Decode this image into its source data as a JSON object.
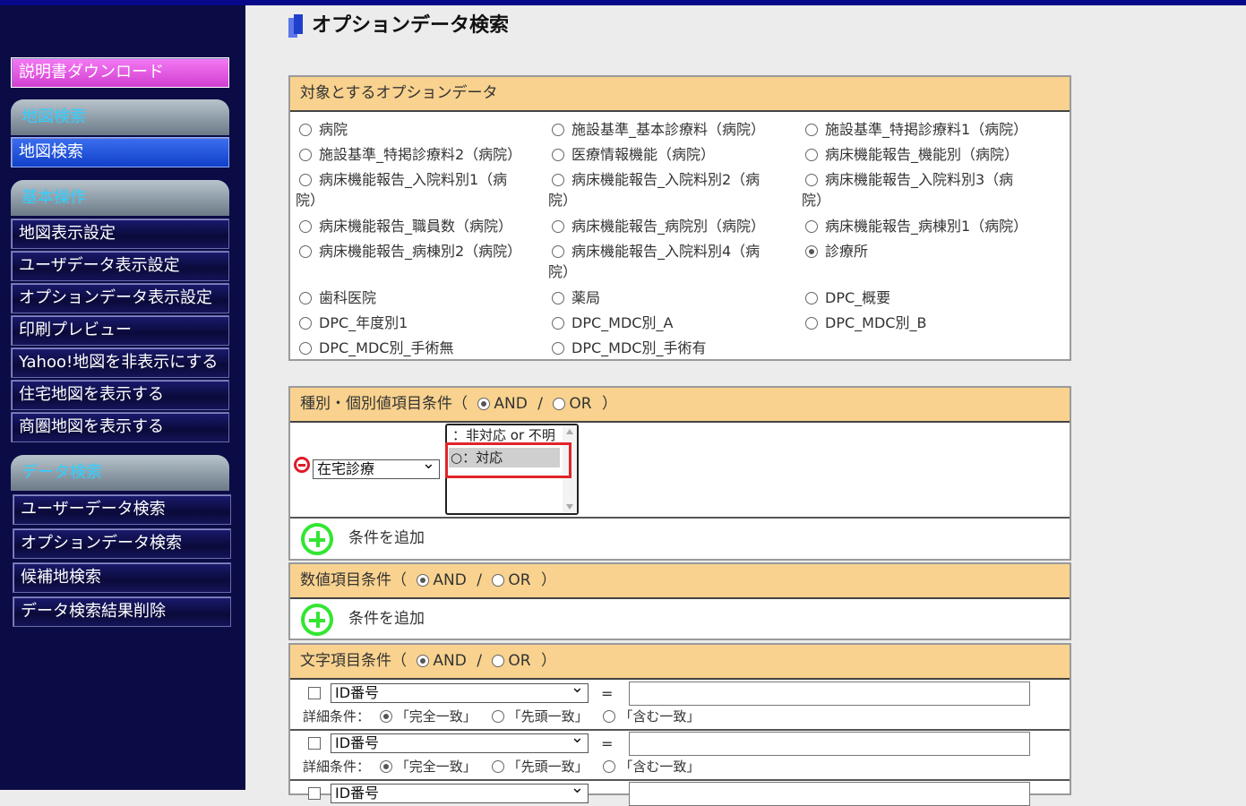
{
  "sidebar": {
    "manual_download": "説明書ダウンロード",
    "sections": [
      {
        "title": "地図検索",
        "items": [
          "地図検索"
        ]
      },
      {
        "title": "基本操作",
        "items": [
          "地図表示設定",
          "ユーザデータ表示設定",
          "オプションデータ表示設定",
          "印刷プレビュー",
          "Yahoo!地図を非表示にする",
          "住宅地図を表示する",
          "商圏地図を表示する"
        ]
      },
      {
        "title": "データ検索",
        "items": [
          "ユーザーデータ検索",
          "オプションデータ検索",
          "候補地検索",
          "データ検索結果削除"
        ]
      }
    ]
  },
  "page_title": "オプションデータ検索",
  "target_panel": {
    "header": "対象とするオプションデータ",
    "selected": "診療所",
    "options": [
      "病院",
      "施設基準_基本診療料（病院）",
      "施設基準_特掲診療料1（病院）",
      "施設基準_特掲診療料2（病院）",
      "医療情報機能（病院）",
      "病床機能報告_機能別（病院）",
      "病床機能報告_入院料別1（病院）",
      "病床機能報告_入院料別2（病院）",
      "病床機能報告_入院料別3（病院）",
      "病床機能報告_職員数（病院）",
      "病床機能報告_病院別（病院）",
      "病床機能報告_病棟別1（病院）",
      "病床機能報告_病棟別2（病院）",
      "病床機能報告_入院料別4（病院）",
      "診療所",
      "歯科医院",
      "薬局",
      "DPC_概要",
      "DPC_年度別1",
      "DPC_MDC別_A",
      "DPC_MDC別_B",
      "DPC_MDC別_手術無",
      "DPC_MDC別_手術有"
    ]
  },
  "category_panel": {
    "header_prefix": "種別・個別値項目条件（",
    "and_label": "AND",
    "slash": "/",
    "or_label": "OR",
    "header_suffix": "）",
    "mode": "AND",
    "field_select": "在宅診療",
    "listbox_items": [
      "：非対応 or 不明",
      "○：対応"
    ],
    "listbox_selected": "○：対応",
    "add_condition": "条件を追加"
  },
  "numeric_panel": {
    "header_prefix": "数値項目条件（",
    "and_label": "AND",
    "slash": "/",
    "or_label": "OR",
    "header_suffix": "）",
    "mode": "AND",
    "add_condition": "条件を追加"
  },
  "text_panel": {
    "header_prefix": "文字項目条件（",
    "and_label": "AND",
    "slash": "/",
    "or_label": "OR",
    "header_suffix": "）",
    "mode": "AND",
    "rows": [
      {
        "field": "ID番号",
        "equals": "=",
        "value": "",
        "detail_label": "詳細条件：",
        "match_options": [
          "「完全一致」",
          "「先頭一致」",
          "「含む一致」"
        ],
        "match_selected": "「完全一致」"
      },
      {
        "field": "ID番号",
        "equals": "=",
        "value": "",
        "detail_label": "詳細条件：",
        "match_options": [
          "「完全一致」",
          "「先頭一致」",
          "「含む一致」"
        ],
        "match_selected": "「完全一致」"
      },
      {
        "field": "ID番号",
        "equals": "=",
        "value": ""
      }
    ]
  },
  "colors": {
    "highlight_box": "#e0242a",
    "panel_header": "#f8d28e",
    "sidebar_bg": "#0b0b45",
    "add_icon": "#32e632",
    "remove_icon": "#e01a2a"
  },
  "icons": {
    "add": "plus-circle-icon",
    "remove": "minus-circle-icon"
  }
}
